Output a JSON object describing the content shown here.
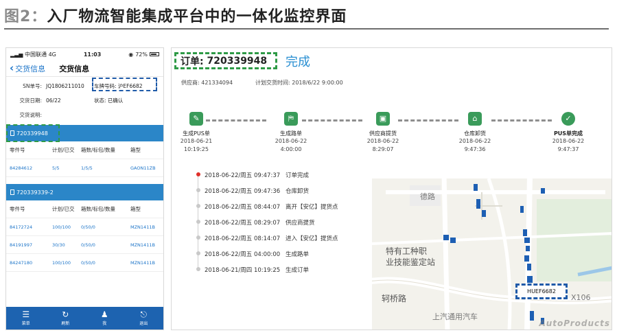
{
  "figure": {
    "title_prefix": "图2：",
    "title": "入厂物流智能集成平台中的一体化监控界面"
  },
  "phone": {
    "status": {
      "carrier": "中国联通",
      "network": "4G",
      "time": "11:03",
      "battery": "72%"
    },
    "nav": {
      "back_label": "交货信息",
      "title": "交货信息"
    },
    "info": {
      "sn_label": "SN单号:",
      "sn_value": "JQ1806211010",
      "plate_label": "车牌号码:",
      "plate_value": "沪EF6682",
      "date_label": "交货日期:",
      "date_value": "06/22",
      "state_label": "状态:",
      "state_value": "已确认",
      "note_label": "交货说明:"
    },
    "columns": [
      "零件号",
      "计划/已交",
      "箱数/标包/数量",
      "箱型"
    ],
    "sections": [
      {
        "id": "720339948",
        "rows": [
          {
            "part": "84284612",
            "plan": "5/5",
            "boxes": "1/5/5",
            "type": "GAON11ZB"
          }
        ]
      },
      {
        "id": "720339339-2",
        "rows": [
          {
            "part": "84172724",
            "plan": "100/100",
            "boxes": "0/50/0",
            "type": "MZN1411B"
          },
          {
            "part": "84191997",
            "plan": "30/30",
            "boxes": "0/50/0",
            "type": "MZN1411B"
          },
          {
            "part": "84247180",
            "plan": "100/100",
            "boxes": "0/50/0",
            "type": "MZN1411B"
          }
        ]
      }
    ],
    "tabs": [
      {
        "label": "菜单",
        "icon": "menu-icon"
      },
      {
        "label": "刷新",
        "icon": "refresh-icon"
      },
      {
        "label": "我",
        "icon": "user-icon"
      },
      {
        "label": "退出",
        "icon": "logout-icon"
      }
    ],
    "colors": {
      "accent": "#2b86c8",
      "tabbar": "#1d63b0"
    }
  },
  "panel": {
    "order_label": "订单:",
    "order_no": "720339948",
    "order_status": "完成",
    "supplier_label": "供应商:",
    "supplier_value": "421334094",
    "plan_time_label": "计划交货时间:",
    "plan_time_value": "2018/6/22 9:00:00",
    "steps": [
      {
        "label": "生成PUS单",
        "date": "2018-06-21",
        "time": "10:19:25",
        "icon": "document-edit-icon"
      },
      {
        "label": "生成路单",
        "date": "2018-06-22",
        "time": "4:00:00",
        "icon": "route-map-icon"
      },
      {
        "label": "供应商提货",
        "date": "2018-06-22",
        "time": "8:29:07",
        "icon": "package-icon"
      },
      {
        "label": "仓库卸货",
        "date": "2018-06-22",
        "time": "9:47:36",
        "icon": "warehouse-icon"
      },
      {
        "label": "PUS单完成",
        "date": "2018-06-22",
        "time": "9:47:37",
        "icon": "complete-icon"
      }
    ],
    "events": [
      {
        "time": "2018-06-22/周五 09:47:37",
        "desc": "订单完成"
      },
      {
        "time": "2018-06-22/周五 09:47:36",
        "desc": "仓库卸货"
      },
      {
        "time": "2018-06-22/周五 08:44:07",
        "desc": "离开【安亿】提货点"
      },
      {
        "time": "2018-06-22/周五 08:29:07",
        "desc": "供应商提货"
      },
      {
        "time": "2018-06-22/周五 08:14:07",
        "desc": "进入【安亿】提货点"
      },
      {
        "time": "2018-06-22/周五 04:00:00",
        "desc": "生成路单"
      },
      {
        "time": "2018-06-21/周四 10:19:25",
        "desc": "生成订单"
      }
    ],
    "map": {
      "vehicle_tag": "HUEF6682",
      "labels": [
        "特有工种职",
        "业技能鉴定站",
        "轲桥路",
        "上汽通用汽车",
        "X106",
        "德路"
      ]
    },
    "watermark": "AutoProducts"
  }
}
